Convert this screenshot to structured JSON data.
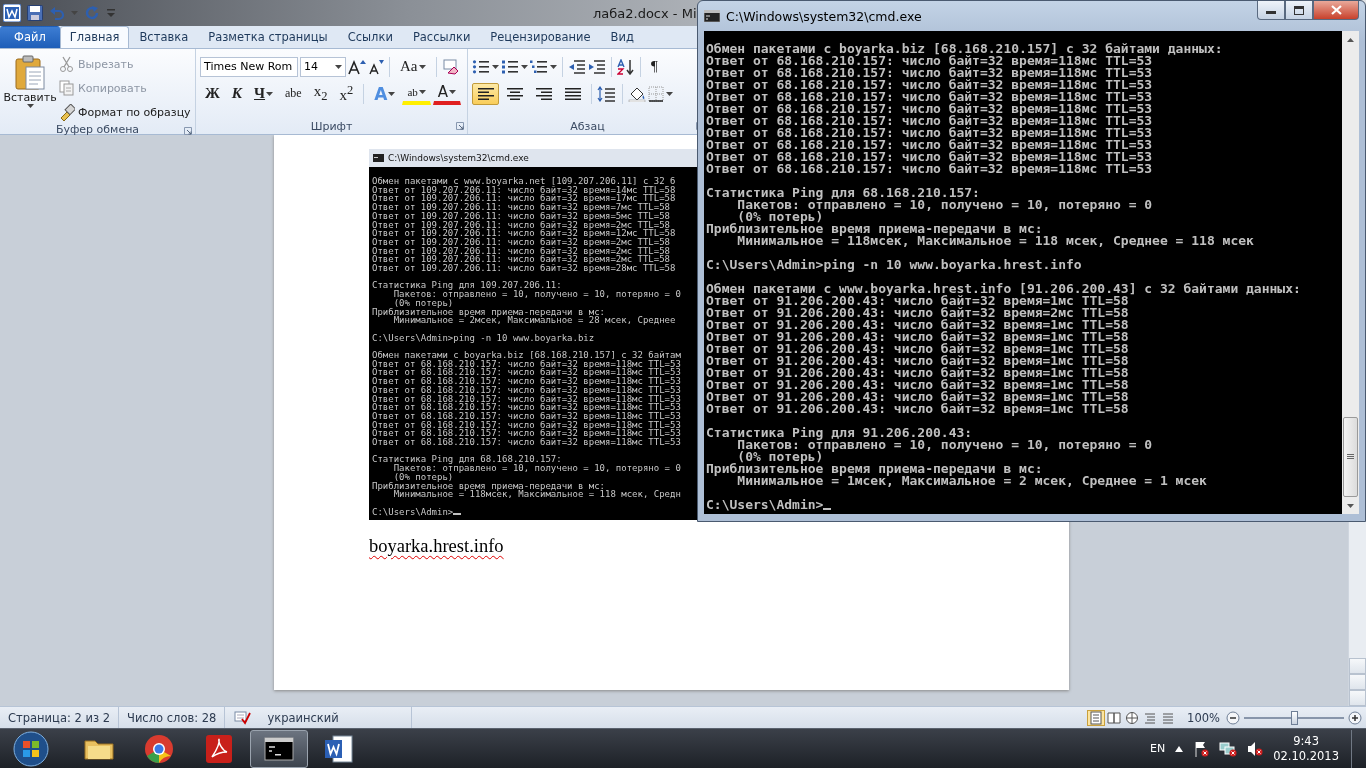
{
  "word": {
    "title": "лаба2.docx - Mi",
    "tabs": [
      {
        "label": "Файл",
        "kind": "file",
        "selected": false
      },
      {
        "label": "Главная",
        "kind": "tab",
        "selected": true
      },
      {
        "label": "Вставка",
        "kind": "tab",
        "selected": false
      },
      {
        "label": "Разметка страницы",
        "kind": "tab",
        "selected": false
      },
      {
        "label": "Ссылки",
        "kind": "tab",
        "selected": false
      },
      {
        "label": "Рассылки",
        "kind": "tab",
        "selected": false
      },
      {
        "label": "Рецензирование",
        "kind": "tab",
        "selected": false
      },
      {
        "label": "Вид",
        "kind": "tab",
        "selected": false
      }
    ],
    "clipboard": {
      "label": "Буфер обмена",
      "paste": "Вставить",
      "commands": [
        {
          "kind": "cut",
          "label": "Вырезать",
          "disabled": true
        },
        {
          "kind": "copy",
          "label": "Копировать",
          "disabled": true
        },
        {
          "kind": "painter",
          "label": "Формат по образцу",
          "disabled": false
        }
      ]
    },
    "font": {
      "label": "Шрифт",
      "font_name": "Times New Rom",
      "size_value": "14",
      "case_button": "Aa",
      "styles": [
        {
          "kind": "bold",
          "label": "Ж"
        },
        {
          "kind": "italic",
          "label": "К"
        },
        {
          "kind": "underline",
          "label": "Ч"
        },
        {
          "kind": "strike",
          "label": "abe"
        },
        {
          "kind": "sub",
          "label": "x$_{2}$"
        },
        {
          "kind": "sup",
          "label": "x$^{2}$"
        }
      ],
      "effects": [
        {
          "kind": "effects",
          "label": "A"
        },
        {
          "kind": "highlight",
          "label": "ab"
        },
        {
          "kind": "color",
          "label": "A"
        }
      ]
    },
    "paragraph": {
      "label": "Абзац",
      "pilcrow": "¶",
      "alignments": [
        {
          "kind": "left",
          "selected": true
        },
        {
          "kind": "center",
          "selected": false
        },
        {
          "kind": "right",
          "selected": false
        },
        {
          "kind": "justify",
          "selected": false
        }
      ]
    },
    "document": {
      "embedded_console": {
        "title": "C:\\Windows\\system32\\cmd.exe",
        "blocks": [
          [
            "Обмен пакетами с www.boyarka.net [109.207.206.11] с 32 б",
            "Ответ от 109.207.206.11: число байт=32 время=14мс TTL=58",
            "Ответ от 109.207.206.11: число байт=32 время=17мс TTL=58",
            "Ответ от 109.207.206.11: число байт=32 время=7мс TTL=58",
            "Ответ от 109.207.206.11: число байт=32 время=5мс TTL=58",
            "Ответ от 109.207.206.11: число байт=32 время=2мс TTL=58",
            "Ответ от 109.207.206.11: число байт=32 время=12мс TTL=58",
            "Ответ от 109.207.206.11: число байт=32 время=2мс TTL=58",
            "Ответ от 109.207.206.11: число байт=32 время=2мс TTL=58",
            "Ответ от 109.207.206.11: число байт=32 время=2мс TTL=58",
            "Ответ от 109.207.206.11: число байт=32 время=28мс TTL=58"
          ],
          [
            "Статистика Ping для 109.207.206.11:",
            "    Пакетов: отправлено = 10, получено = 10, потеряно = 0",
            "    (0% потерь)",
            "Приблизительное время приема-передачи в мс:",
            "    Минимальное = 2мсек, Максимальное = 28 мсек, Среднее"
          ],
          [
            "C:\\Users\\Admin>ping -n 10 www.boyarka.biz"
          ],
          [
            "Обмен пакетами с boyarka.biz [68.168.210.157] с 32 байтам",
            "Ответ от 68.168.210.157: число байт=32 время=118мс TTL=53",
            "Ответ от 68.168.210.157: число байт=32 время=118мс TTL=53",
            "Ответ от 68.168.210.157: число байт=32 время=118мс TTL=53",
            "Ответ от 68.168.210.157: число байт=32 время=118мс TTL=53",
            "Ответ от 68.168.210.157: число байт=32 время=118мс TTL=53",
            "Ответ от 68.168.210.157: число байт=32 время=118мс TTL=53",
            "Ответ от 68.168.210.157: число байт=32 время=118мс TTL=53",
            "Ответ от 68.168.210.157: число байт=32 время=118мс TTL=53",
            "Ответ от 68.168.210.157: число байт=32 время=118мс TTL=53",
            "Ответ от 68.168.210.157: число байт=32 время=118мс TTL=53"
          ],
          [
            "Статистика Ping для 68.168.210.157:",
            "    Пакетов: отправлено = 10, получено = 10, потеряно = 0",
            "    (0% потерь)",
            "Приблизительное время приема-передачи в мс:",
            "    Минимальное = 118мсек, Максимальное = 118 мсек, Средн"
          ],
          [
            "C:\\Users\\Admin>"
          ]
        ],
        "cursor": true
      },
      "text": "boyarka.hrest.info",
      "misspelled": true
    },
    "status_bar": {
      "page": "Страница: 2 из 2",
      "words": "Число слов: 28",
      "language": "украинский",
      "views": [
        {
          "kind": "print",
          "selected": true
        },
        {
          "kind": "reading",
          "selected": false
        },
        {
          "kind": "web",
          "selected": false
        },
        {
          "kind": "outline",
          "selected": false
        },
        {
          "kind": "draft",
          "selected": false
        }
      ],
      "zoom": "100%",
      "zoom_slider": {
        "level": 0.5
      }
    }
  },
  "console": {
    "title": "C:\\Windows\\system32\\cmd.exe",
    "blocks": [
      [
        "Обмен пакетами с boyarka.biz [68.168.210.157] с 32 байтами данных:",
        "Ответ от 68.168.210.157: число байт=32 время=118мс TTL=53",
        "Ответ от 68.168.210.157: число байт=32 время=118мс TTL=53",
        "Ответ от 68.168.210.157: число байт=32 время=118мс TTL=53",
        "Ответ от 68.168.210.157: число байт=32 время=118мс TTL=53",
        "Ответ от 68.168.210.157: число байт=32 время=118мс TTL=53",
        "Ответ от 68.168.210.157: число байт=32 время=118мс TTL=53",
        "Ответ от 68.168.210.157: число байт=32 время=118мс TTL=53",
        "Ответ от 68.168.210.157: число байт=32 время=118мс TTL=53",
        "Ответ от 68.168.210.157: число байт=32 время=118мс TTL=53",
        "Ответ от 68.168.210.157: число байт=32 время=118мс TTL=53"
      ],
      [
        "Статистика Ping для 68.168.210.157:",
        "    Пакетов: отправлено = 10, получено = 10, потеряно = 0",
        "    (0% потерь)",
        "Приблизительное время приема-передачи в мс:",
        "    Минимальное = 118мсек, Максимальное = 118 мсек, Среднее = 118 мсек"
      ],
      [
        "C:\\Users\\Admin>ping -n 10 www.boyarka.hrest.info"
      ],
      [
        "Обмен пакетами с www.boyarka.hrest.info [91.206.200.43] с 32 байтами данных:",
        "Ответ от 91.206.200.43: число байт=32 время=1мс TTL=58",
        "Ответ от 91.206.200.43: число байт=32 время=2мс TTL=58",
        "Ответ от 91.206.200.43: число байт=32 время=1мс TTL=58",
        "Ответ от 91.206.200.43: число байт=32 время=1мс TTL=58",
        "Ответ от 91.206.200.43: число байт=32 время=1мс TTL=58",
        "Ответ от 91.206.200.43: число байт=32 время=1мс TTL=58",
        "Ответ от 91.206.200.43: число байт=32 время=1мс TTL=58",
        "Ответ от 91.206.200.43: число байт=32 время=1мс TTL=58",
        "Ответ от 91.206.200.43: число байт=32 время=1мс TTL=58",
        "Ответ от 91.206.200.43: число байт=32 время=1мс TTL=58"
      ],
      [
        "Статистика Ping для 91.206.200.43:",
        "    Пакетов: отправлено = 10, получено = 10, потеряно = 0",
        "    (0% потерь)",
        "Приблизительное время приема-передачи в мс:",
        "    Минимальное = 1мсек, Максимальное = 2 мсек, Среднее = 1 мсек"
      ],
      [
        "C:\\Users\\Admin>"
      ]
    ],
    "cursor": true
  },
  "taskbar": {
    "apps": [
      {
        "kind": "explorer",
        "selected": false
      },
      {
        "kind": "browser",
        "selected": false
      },
      {
        "kind": "pdf",
        "selected": false
      },
      {
        "kind": "console",
        "selected": true
      },
      {
        "kind": "word",
        "selected": false
      }
    ],
    "language": "EN",
    "time": "9:43",
    "date": "02.10.2013"
  }
}
